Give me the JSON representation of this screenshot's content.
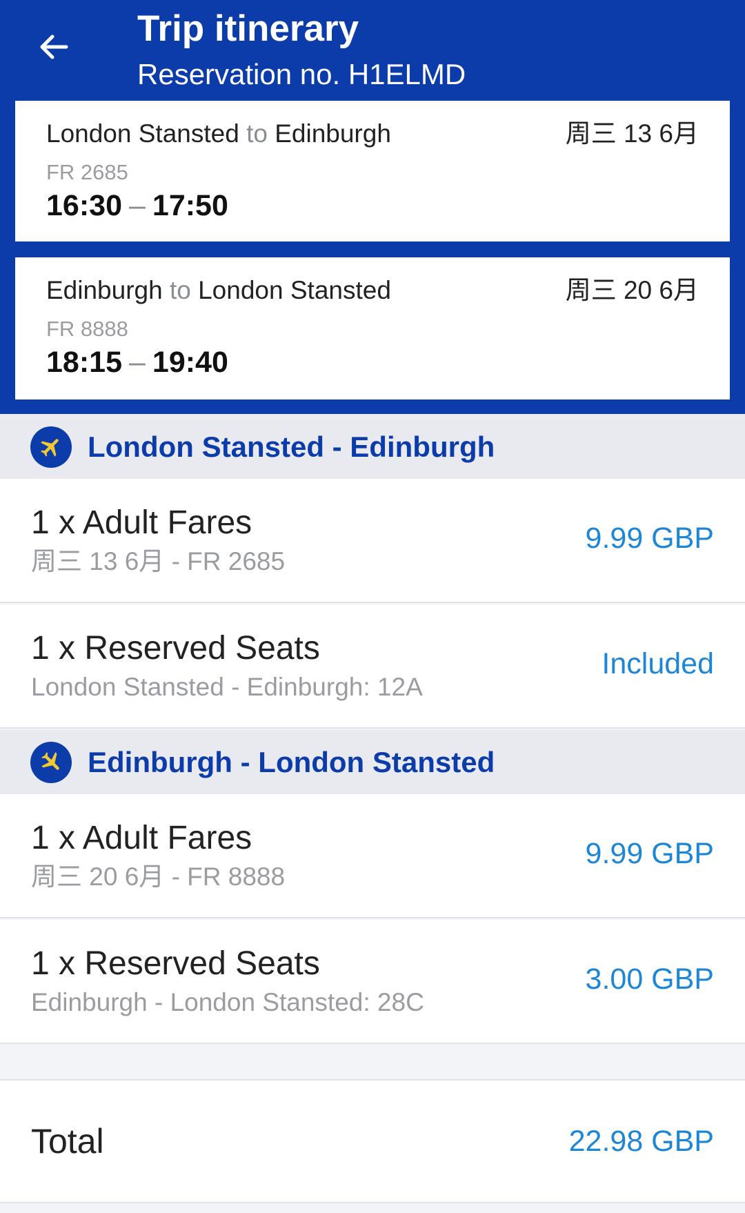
{
  "header": {
    "title": "Trip itinerary",
    "subtitle": "Reservation no. H1ELMD"
  },
  "flights": [
    {
      "from": "London Stansted",
      "connector": "to",
      "to": "Edinburgh",
      "date": "周三 13 6月",
      "flight_no": "FR 2685",
      "depart": "16:30",
      "separator": "–",
      "arrive": "17:50"
    },
    {
      "from": "Edinburgh",
      "connector": "to",
      "to": "London Stansted",
      "date": "周三 20 6月",
      "flight_no": "FR 8888",
      "depart": "18:15",
      "separator": "–",
      "arrive": "19:40"
    }
  ],
  "sections": [
    {
      "title": "London Stansted - Edinburgh",
      "icon": "plane-icon",
      "items": [
        {
          "title": "1 x Adult Fares",
          "subtitle": "周三 13 6月 - FR 2685",
          "price": "9.99 GBP"
        },
        {
          "title": "1 x Reserved Seats",
          "subtitle": "London Stansted - Edinburgh: 12A",
          "price": "Included"
        }
      ]
    },
    {
      "title": "Edinburgh - London Stansted",
      "icon": "plane-icon",
      "items": [
        {
          "title": "1 x Adult Fares",
          "subtitle": "周三 20 6月 - FR 8888",
          "price": "9.99 GBP"
        },
        {
          "title": "1 x Reserved Seats",
          "subtitle": "Edinburgh - London Stansted: 28C",
          "price": "3.00 GBP"
        }
      ]
    }
  ],
  "total": {
    "label": "Total",
    "value": "22.98 GBP"
  },
  "colors": {
    "brand_blue": "#0c3caa",
    "accent_yellow": "#f1c933",
    "price_blue": "#1d86d6",
    "band_gray": "#e9eaef"
  }
}
